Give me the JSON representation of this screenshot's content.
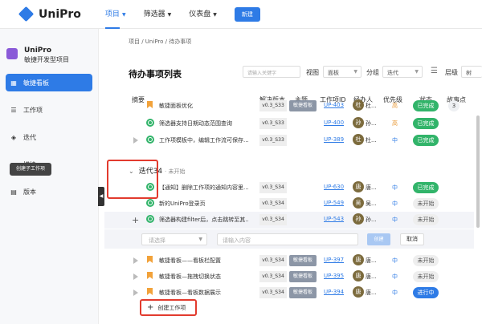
{
  "app": {
    "name": "UniPro"
  },
  "topnav": {
    "items": [
      "项目",
      "筛选器",
      "仪表盘"
    ],
    "new_label": "新建"
  },
  "sidebar": {
    "project_name": "UniPro",
    "project_sub": "敏捷开发型项目",
    "items": [
      {
        "label": "敏捷看板",
        "icon": "board-icon",
        "active": true
      },
      {
        "label": "工作项",
        "icon": "list-icon",
        "active": false
      },
      {
        "label": "迭代",
        "icon": "layers-icon",
        "active": false
      },
      {
        "label": "模块",
        "icon": "module-icon",
        "active": false
      },
      {
        "label": "版本",
        "icon": "version-icon",
        "active": false
      }
    ]
  },
  "breadcrumb": "项目 / UniPro / 待办事项",
  "page_title": "待办事项列表",
  "toolbar": {
    "search_placeholder": "请输入关键字",
    "view_label": "视图",
    "view_value": "面板",
    "group_label": "分组",
    "group_value": "迭代",
    "level_label": "层级",
    "level_value": "树"
  },
  "columns": [
    "摘要",
    "解决版本",
    "主题",
    "工作项ID",
    "经办人",
    "优先级",
    "状态",
    "故事点"
  ],
  "rows_top": [
    {
      "title": "敏捷面板优化",
      "version": "v0.3_S33",
      "theme": "敏捷看板",
      "id": "UP-403",
      "owner": "杜...",
      "avatar": "杜",
      "priority": "高",
      "status": "已完成",
      "status_type": "done",
      "points": "3",
      "kind": "flag"
    },
    {
      "title": "筛选器支持日期动态范围查询",
      "version": "v0.3_S33",
      "theme": "",
      "id": "UP-400",
      "owner": "孙...",
      "avatar": "孙",
      "priority": "高",
      "status": "已完成",
      "status_type": "done",
      "points": "",
      "kind": "ring"
    },
    {
      "title": "工作项模板中，编辑工作流可保存...",
      "version": "v0.3_S33",
      "theme": "",
      "id": "UP-389",
      "owner": "杜...",
      "avatar": "杜",
      "priority": "中",
      "status": "已完成",
      "status_type": "done",
      "points": "",
      "kind": "tri"
    }
  ],
  "iteration": {
    "name": "迭代34",
    "sub": "· 未开始"
  },
  "rows_mid": [
    {
      "title": "【通知】删除工作项的通知内容里...",
      "version": "v0.3_S34",
      "theme": "",
      "id": "UP-630",
      "owner": "唐...",
      "avatar": "唐",
      "priority": "中",
      "status": "已完成",
      "status_type": "done",
      "points": "",
      "kind": "ring"
    },
    {
      "title": "新的UniPro登录页",
      "version": "v0.3_S34",
      "theme": "",
      "id": "UP-549",
      "owner": "吴...",
      "avatar": "吴",
      "priority": "中",
      "status": "未开始",
      "status_type": "todo",
      "points": "",
      "kind": "ring"
    },
    {
      "title": "筛选器构建filter后，点击跳转至其...",
      "version": "v0.3_S34",
      "theme": "",
      "id": "UP-543",
      "owner": "孙...",
      "avatar": "孙",
      "priority": "中",
      "status": "未开始",
      "status_type": "todo",
      "points": "",
      "kind": "ring"
    }
  ],
  "tooltip": "创建子工作项",
  "create_form": {
    "type_placeholder": "请选择",
    "input_placeholder": "请输入内容",
    "create_label": "创建",
    "cancel_label": "取消"
  },
  "rows_bottom": [
    {
      "title": "敏捷看板——看板栏配置",
      "version": "v0.3_S34",
      "theme": "敏捷看板",
      "id": "UP-397",
      "owner": "唐...",
      "avatar": "唐",
      "priority": "中",
      "status": "未开始",
      "status_type": "todo",
      "points": "",
      "kind": "flag"
    },
    {
      "title": "敏捷看板—拖拽切换状态",
      "version": "v0.3_S34",
      "theme": "敏捷看板",
      "id": "UP-395",
      "owner": "唐...",
      "avatar": "唐",
      "priority": "中",
      "status": "未开始",
      "status_type": "todo",
      "points": "",
      "kind": "flag"
    },
    {
      "title": "敏捷看板—看板数据展示",
      "version": "v0.3_S34",
      "theme": "敏捷看板",
      "id": "UP-394",
      "owner": "唐...",
      "avatar": "唐",
      "priority": "中",
      "status": "进行中",
      "status_type": "doing",
      "points": "",
      "kind": "flag"
    }
  ],
  "create_item_label": "创建工作项"
}
